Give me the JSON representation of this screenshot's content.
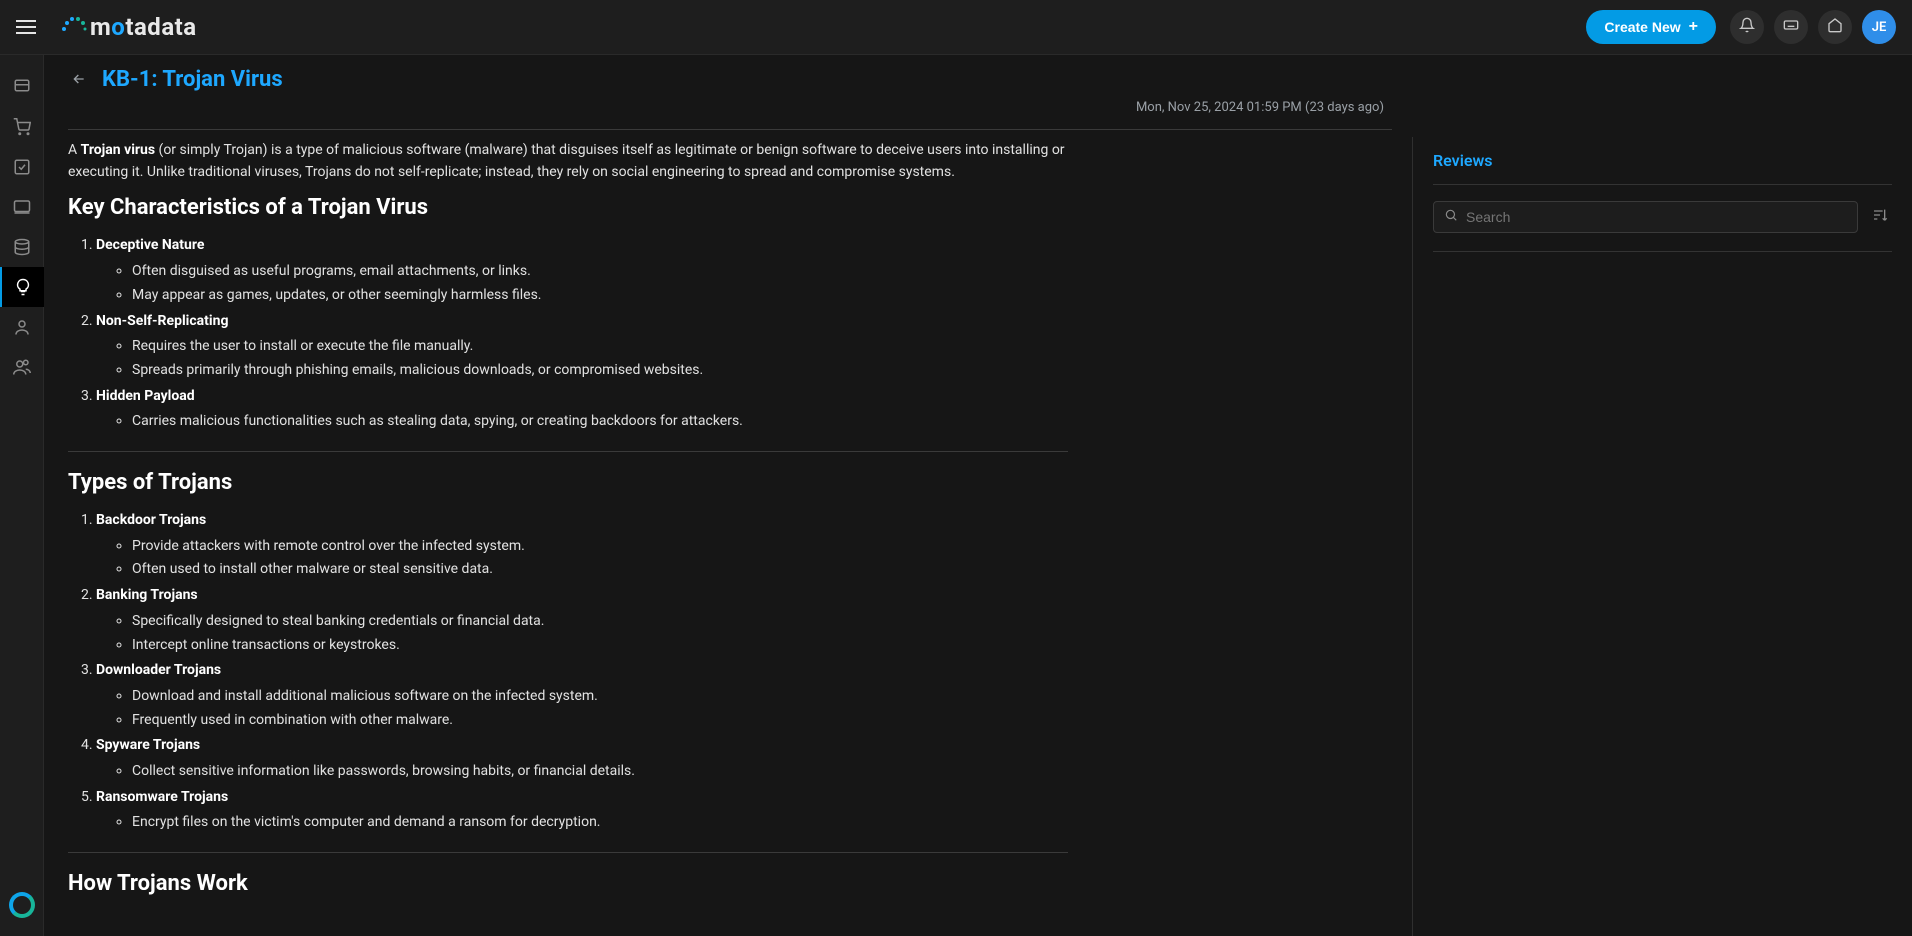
{
  "header": {
    "create_label": "Create New",
    "avatar_initials": "JE"
  },
  "page": {
    "kb_id_title": "KB-1: Trojan Virus",
    "timestamp": "Mon, Nov 25, 2024 01:59 PM (23 days ago)"
  },
  "article": {
    "intro_prefix": "A ",
    "intro_bold": "Trojan virus",
    "intro_rest": " (or simply Trojan) is a type of malicious software (malware) that disguises itself as legitimate or benign software to deceive users into installing or executing it. Unlike traditional viruses, Trojans do not self-replicate; instead, they rely on social engineering to spread and compromise systems.",
    "h_key": "Key Characteristics of a Trojan Virus",
    "key_items": [
      {
        "head": "Deceptive Nature",
        "bullets": [
          "Often disguised as useful programs, email attachments, or links.",
          "May appear as games, updates, or other seemingly harmless files."
        ]
      },
      {
        "head": "Non-Self-Replicating",
        "bullets": [
          "Requires the user to install or execute the file manually.",
          "Spreads primarily through phishing emails, malicious downloads, or compromised websites."
        ]
      },
      {
        "head": "Hidden Payload",
        "bullets": [
          "Carries malicious functionalities such as stealing data, spying, or creating backdoors for attackers."
        ]
      }
    ],
    "h_types": "Types of Trojans",
    "type_items": [
      {
        "head": "Backdoor Trojans",
        "bullets": [
          "Provide attackers with remote control over the infected system.",
          "Often used to install other malware or steal sensitive data."
        ]
      },
      {
        "head": "Banking Trojans",
        "bullets": [
          "Specifically designed to steal banking credentials or financial data.",
          "Intercept online transactions or keystrokes."
        ]
      },
      {
        "head": "Downloader Trojans",
        "bullets": [
          "Download and install additional malicious software on the infected system.",
          "Frequently used in combination with other malware."
        ]
      },
      {
        "head": "Spyware Trojans",
        "bullets": [
          "Collect sensitive information like passwords, browsing habits, or financial details."
        ]
      },
      {
        "head": "Ransomware Trojans",
        "bullets": [
          "Encrypt files on the victim's computer and demand a ransom for decryption."
        ]
      }
    ],
    "h_how": "How Trojans Work"
  },
  "reviews": {
    "heading": "Reviews",
    "search_placeholder": "Search"
  },
  "logo": {
    "text_m": "m",
    "text_o": "o",
    "text_rest": "tadata"
  }
}
